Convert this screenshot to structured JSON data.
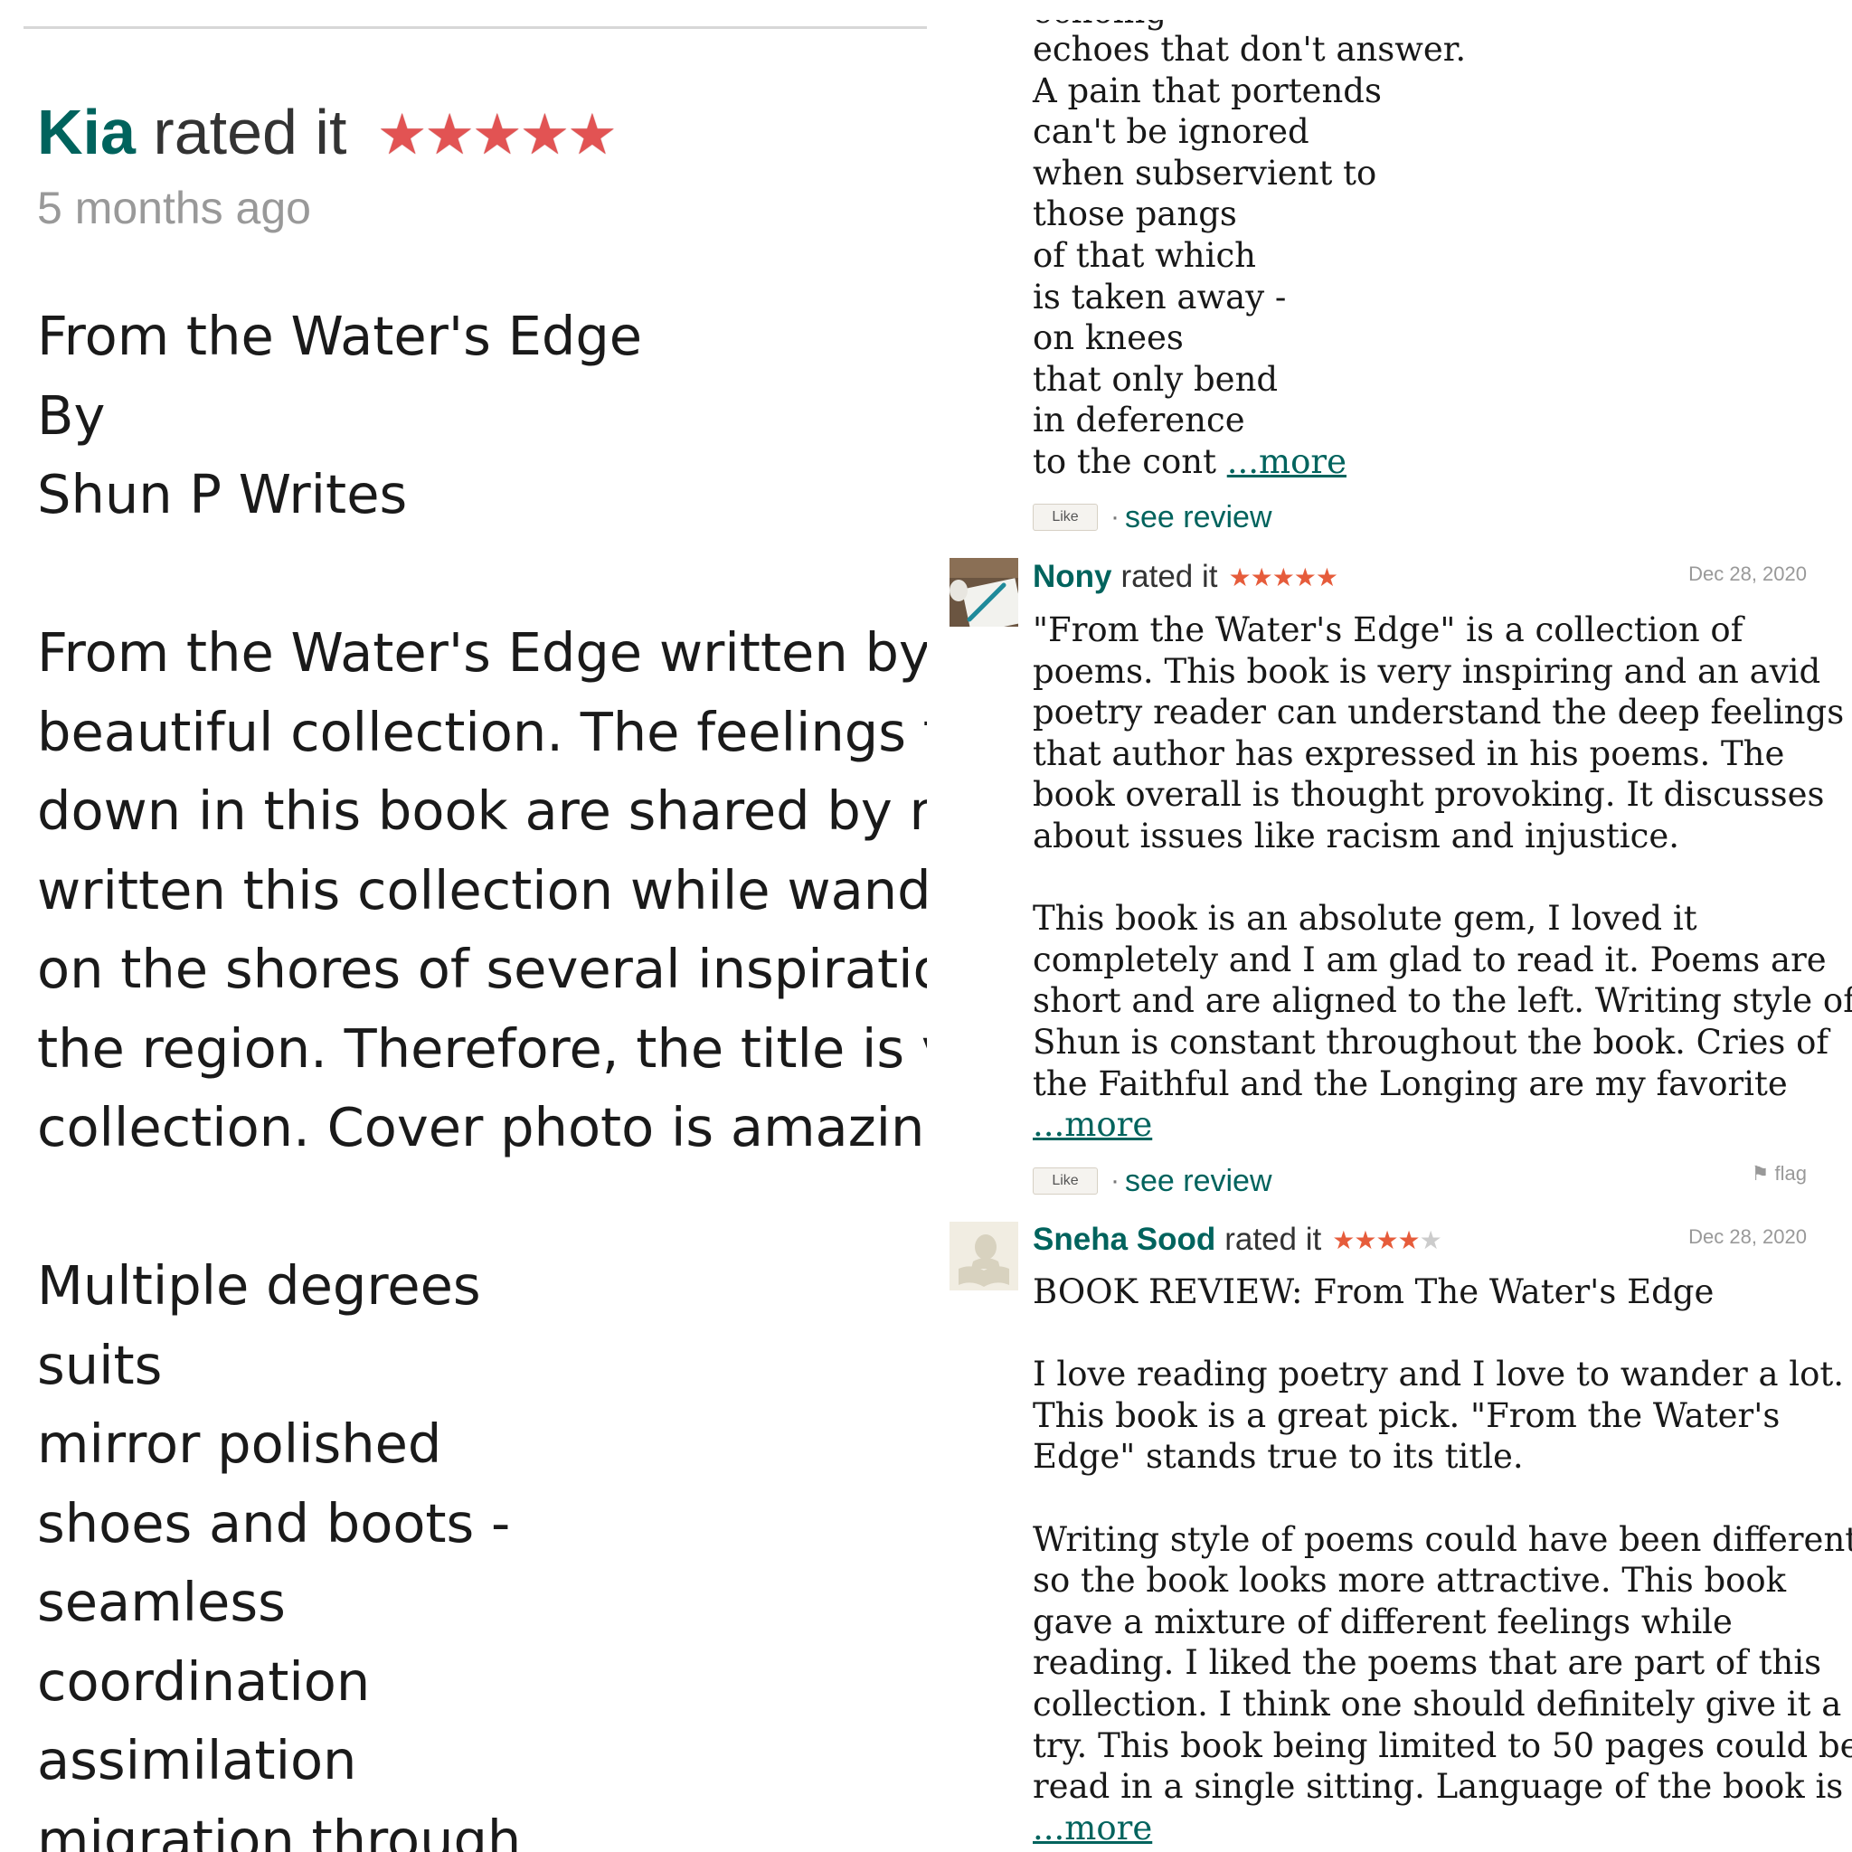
{
  "left_review": {
    "reviewer": "Kia",
    "rated_text": "rated it",
    "stars": "★★★★★",
    "rating": 5,
    "time_ago": "5 months ago",
    "lines": [
      "From the Water's Edge",
      "By",
      "Shun P Writes",
      "",
      "From the Water's Edge written by S",
      "beautiful collection. The feelings t",
      "down in this book are shared by m",
      "written this collection while wande",
      "on the shores of several inspiratio",
      "the region. Therefore, the title is ve",
      "collection. Cover photo is amazing",
      "",
      "Multiple degrees",
      "suits",
      "mirror polished",
      "shoes and boots -",
      "seamless",
      "coordination",
      "assimilation",
      "migration through"
    ]
  },
  "right_reviews": {
    "first_review": {
      "partial_top_line": "echoing",
      "lines": [
        "echoes that don't answer.",
        "A pain that portends",
        "can't be ignored",
        "when subservient to",
        "those pangs",
        "of that which",
        "is taken away -",
        "on knees",
        "that only bend",
        "in deference"
      ],
      "last_line": "to the cont",
      "more_label": "...more",
      "like_label": "Like",
      "see_review_label": "see review"
    },
    "nony": {
      "name": "Nony",
      "rated_text": "rated it",
      "stars": "★★★★★",
      "rating": 5,
      "date": "Dec 28, 2020",
      "lines": [
        "\"From the Water's Edge\" is a collection of",
        "poems. This book is very inspiring and an avid",
        "poetry reader can understand the deep feelings",
        "that author has expressed in his poems. The",
        "book overall is thought provoking. It discusses",
        "about issues like racism and injustice.",
        "",
        "This book is an absolute gem, I loved it",
        "completely and I am glad to read it. Poems are",
        "short and are aligned to the left. Writing style of",
        "Shun is constant throughout the book. Cries of",
        "the Faithful and the Longing are my favorite"
      ],
      "more_label": "...more",
      "like_label": "Like",
      "see_review_label": "see review",
      "flag_label": "flag"
    },
    "sneha": {
      "name": "Sneha Sood",
      "rated_text": "rated it",
      "stars_filled": "★★★★",
      "stars_empty": "★",
      "rating": 4,
      "date": "Dec 28, 2020",
      "lines": [
        "BOOK REVIEW: From The Water's Edge",
        "",
        "I love reading poetry and I love to wander a lot.",
        "This book is a great pick. \"From the Water's",
        "Edge\" stands true to its title.",
        "",
        "Writing style of poems could have been different",
        "so the book looks more attractive. This book",
        "gave a mixture of different feelings while",
        "reading. I liked the poems that are part of this",
        "collection. I think one should definitely give it a",
        "try. This book being limited to 50 pages could be",
        "read in a single sitting. Language of the book is l"
      ],
      "more_label": "...more"
    }
  },
  "colors": {
    "link_green": "#00635d",
    "star_red": "#e25353",
    "star_orange": "#e65c3b",
    "muted_gray": "#999999"
  }
}
